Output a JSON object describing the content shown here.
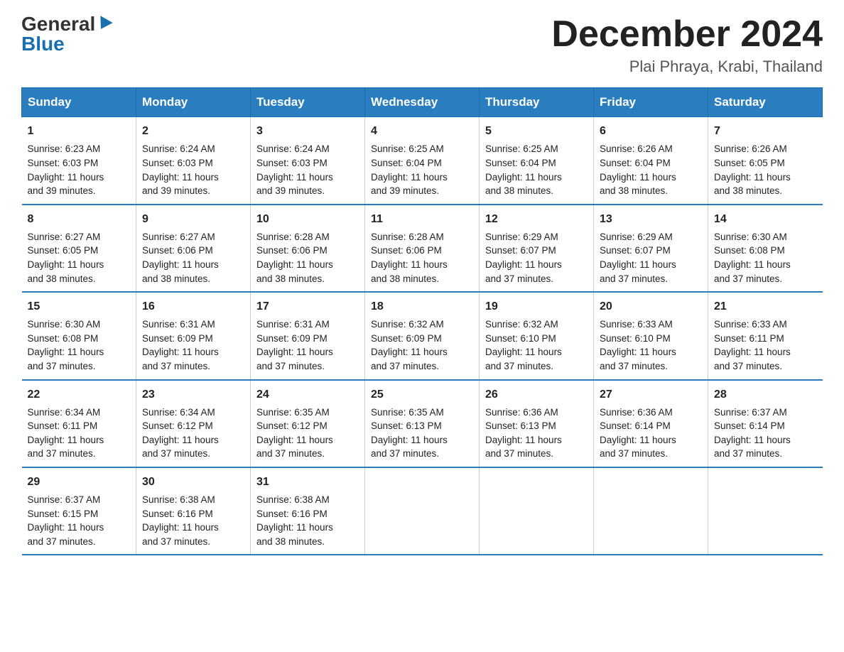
{
  "logo": {
    "general": "General",
    "blue": "Blue"
  },
  "title": "December 2024",
  "subtitle": "Plai Phraya, Krabi, Thailand",
  "days": [
    "Sunday",
    "Monday",
    "Tuesday",
    "Wednesday",
    "Thursday",
    "Friday",
    "Saturday"
  ],
  "weeks": [
    [
      {
        "day": "1",
        "sunrise": "6:23 AM",
        "sunset": "6:03 PM",
        "daylight": "11 hours and 39 minutes."
      },
      {
        "day": "2",
        "sunrise": "6:24 AM",
        "sunset": "6:03 PM",
        "daylight": "11 hours and 39 minutes."
      },
      {
        "day": "3",
        "sunrise": "6:24 AM",
        "sunset": "6:03 PM",
        "daylight": "11 hours and 39 minutes."
      },
      {
        "day": "4",
        "sunrise": "6:25 AM",
        "sunset": "6:04 PM",
        "daylight": "11 hours and 39 minutes."
      },
      {
        "day": "5",
        "sunrise": "6:25 AM",
        "sunset": "6:04 PM",
        "daylight": "11 hours and 38 minutes."
      },
      {
        "day": "6",
        "sunrise": "6:26 AM",
        "sunset": "6:04 PM",
        "daylight": "11 hours and 38 minutes."
      },
      {
        "day": "7",
        "sunrise": "6:26 AM",
        "sunset": "6:05 PM",
        "daylight": "11 hours and 38 minutes."
      }
    ],
    [
      {
        "day": "8",
        "sunrise": "6:27 AM",
        "sunset": "6:05 PM",
        "daylight": "11 hours and 38 minutes."
      },
      {
        "day": "9",
        "sunrise": "6:27 AM",
        "sunset": "6:06 PM",
        "daylight": "11 hours and 38 minutes."
      },
      {
        "day": "10",
        "sunrise": "6:28 AM",
        "sunset": "6:06 PM",
        "daylight": "11 hours and 38 minutes."
      },
      {
        "day": "11",
        "sunrise": "6:28 AM",
        "sunset": "6:06 PM",
        "daylight": "11 hours and 38 minutes."
      },
      {
        "day": "12",
        "sunrise": "6:29 AM",
        "sunset": "6:07 PM",
        "daylight": "11 hours and 37 minutes."
      },
      {
        "day": "13",
        "sunrise": "6:29 AM",
        "sunset": "6:07 PM",
        "daylight": "11 hours and 37 minutes."
      },
      {
        "day": "14",
        "sunrise": "6:30 AM",
        "sunset": "6:08 PM",
        "daylight": "11 hours and 37 minutes."
      }
    ],
    [
      {
        "day": "15",
        "sunrise": "6:30 AM",
        "sunset": "6:08 PM",
        "daylight": "11 hours and 37 minutes."
      },
      {
        "day": "16",
        "sunrise": "6:31 AM",
        "sunset": "6:09 PM",
        "daylight": "11 hours and 37 minutes."
      },
      {
        "day": "17",
        "sunrise": "6:31 AM",
        "sunset": "6:09 PM",
        "daylight": "11 hours and 37 minutes."
      },
      {
        "day": "18",
        "sunrise": "6:32 AM",
        "sunset": "6:09 PM",
        "daylight": "11 hours and 37 minutes."
      },
      {
        "day": "19",
        "sunrise": "6:32 AM",
        "sunset": "6:10 PM",
        "daylight": "11 hours and 37 minutes."
      },
      {
        "day": "20",
        "sunrise": "6:33 AM",
        "sunset": "6:10 PM",
        "daylight": "11 hours and 37 minutes."
      },
      {
        "day": "21",
        "sunrise": "6:33 AM",
        "sunset": "6:11 PM",
        "daylight": "11 hours and 37 minutes."
      }
    ],
    [
      {
        "day": "22",
        "sunrise": "6:34 AM",
        "sunset": "6:11 PM",
        "daylight": "11 hours and 37 minutes."
      },
      {
        "day": "23",
        "sunrise": "6:34 AM",
        "sunset": "6:12 PM",
        "daylight": "11 hours and 37 minutes."
      },
      {
        "day": "24",
        "sunrise": "6:35 AM",
        "sunset": "6:12 PM",
        "daylight": "11 hours and 37 minutes."
      },
      {
        "day": "25",
        "sunrise": "6:35 AM",
        "sunset": "6:13 PM",
        "daylight": "11 hours and 37 minutes."
      },
      {
        "day": "26",
        "sunrise": "6:36 AM",
        "sunset": "6:13 PM",
        "daylight": "11 hours and 37 minutes."
      },
      {
        "day": "27",
        "sunrise": "6:36 AM",
        "sunset": "6:14 PM",
        "daylight": "11 hours and 37 minutes."
      },
      {
        "day": "28",
        "sunrise": "6:37 AM",
        "sunset": "6:14 PM",
        "daylight": "11 hours and 37 minutes."
      }
    ],
    [
      {
        "day": "29",
        "sunrise": "6:37 AM",
        "sunset": "6:15 PM",
        "daylight": "11 hours and 37 minutes."
      },
      {
        "day": "30",
        "sunrise": "6:38 AM",
        "sunset": "6:16 PM",
        "daylight": "11 hours and 37 minutes."
      },
      {
        "day": "31",
        "sunrise": "6:38 AM",
        "sunset": "6:16 PM",
        "daylight": "11 hours and 38 minutes."
      },
      null,
      null,
      null,
      null
    ]
  ],
  "labels": {
    "sunrise": "Sunrise:",
    "sunset": "Sunset:",
    "daylight": "Daylight:"
  }
}
